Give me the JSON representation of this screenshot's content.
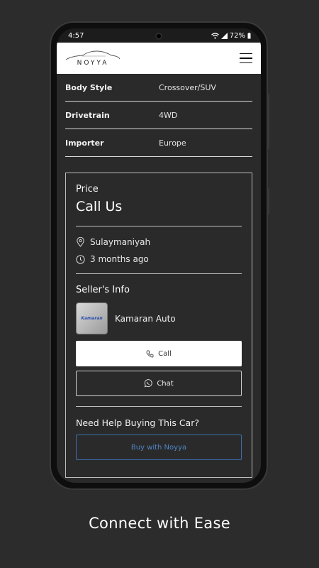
{
  "status_bar": {
    "time": "4:57",
    "battery": "72%"
  },
  "brand": {
    "name": "NOYYA"
  },
  "specs": [
    {
      "label": "Body Style",
      "value": "Crossover/SUV"
    },
    {
      "label": "Drivetrain",
      "value": "4WD"
    },
    {
      "label": "Importer",
      "value": "Europe"
    }
  ],
  "price": {
    "label": "Price",
    "value": "Call Us"
  },
  "location": "Sulaymaniyah",
  "posted": "3 months ago",
  "seller": {
    "title": "Seller's Info",
    "name": "Kamaran Auto",
    "logo_text": "Kamaran"
  },
  "actions": {
    "call_label": "Call",
    "chat_label": "Chat"
  },
  "help": {
    "title": "Need Help Buying This Car?",
    "button_label": "Buy with Noyya"
  },
  "caption": "Connect with Ease",
  "colors": {
    "background": "#2c2c2c",
    "accent": "#4f86c6"
  }
}
